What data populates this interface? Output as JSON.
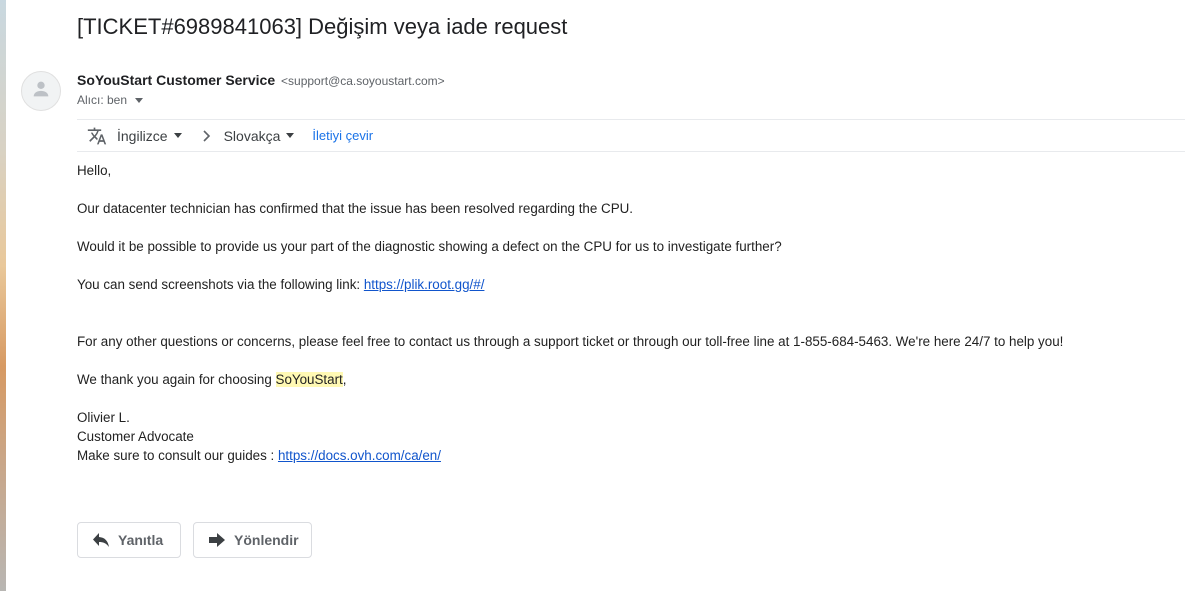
{
  "email": {
    "subject": "[TICKET#6989841063] Değişim veya iade request",
    "sender_name": "SoYouStart Customer Service",
    "sender_email": "<support@ca.soyoustart.com>",
    "recipient": "Alıcı: ben"
  },
  "translate": {
    "source_language": "İngilizce",
    "target_language": "Slovakça",
    "translate_link": "İletiyi çevir"
  },
  "body": {
    "greeting": "Hello,",
    "p1": "Our datacenter technician has confirmed that the issue has been resolved regarding the CPU.",
    "p2": "Would it be possible to provide us your part of the diagnostic showing a defect on the CPU for us to investigate further?",
    "p3_prefix": "You can send screenshots via the following link: ",
    "p3_link": "https://plik.root.gg/#/",
    "p4": "For any other questions or concerns, please feel free to contact us through a support ticket or through our toll-free line at 1-855-684-5463. We're here 24/7 to help you!",
    "p5_prefix": "We thank you again for choosing ",
    "p5_highlight": "SoYouStart",
    "p5_suffix": ",",
    "sig_name": "Olivier L.",
    "sig_title": "Customer Advocate",
    "sig_guides_prefix": "Make sure to consult our guides : ",
    "sig_guides_link": "https://docs.ovh.com/ca/en/"
  },
  "actions": {
    "reply_label": "Yanıtla",
    "forward_label": "Yönlendir"
  },
  "colors": {
    "link": "#1155cc",
    "accent_link": "#1a73e8",
    "highlight": "#fff9b4"
  }
}
